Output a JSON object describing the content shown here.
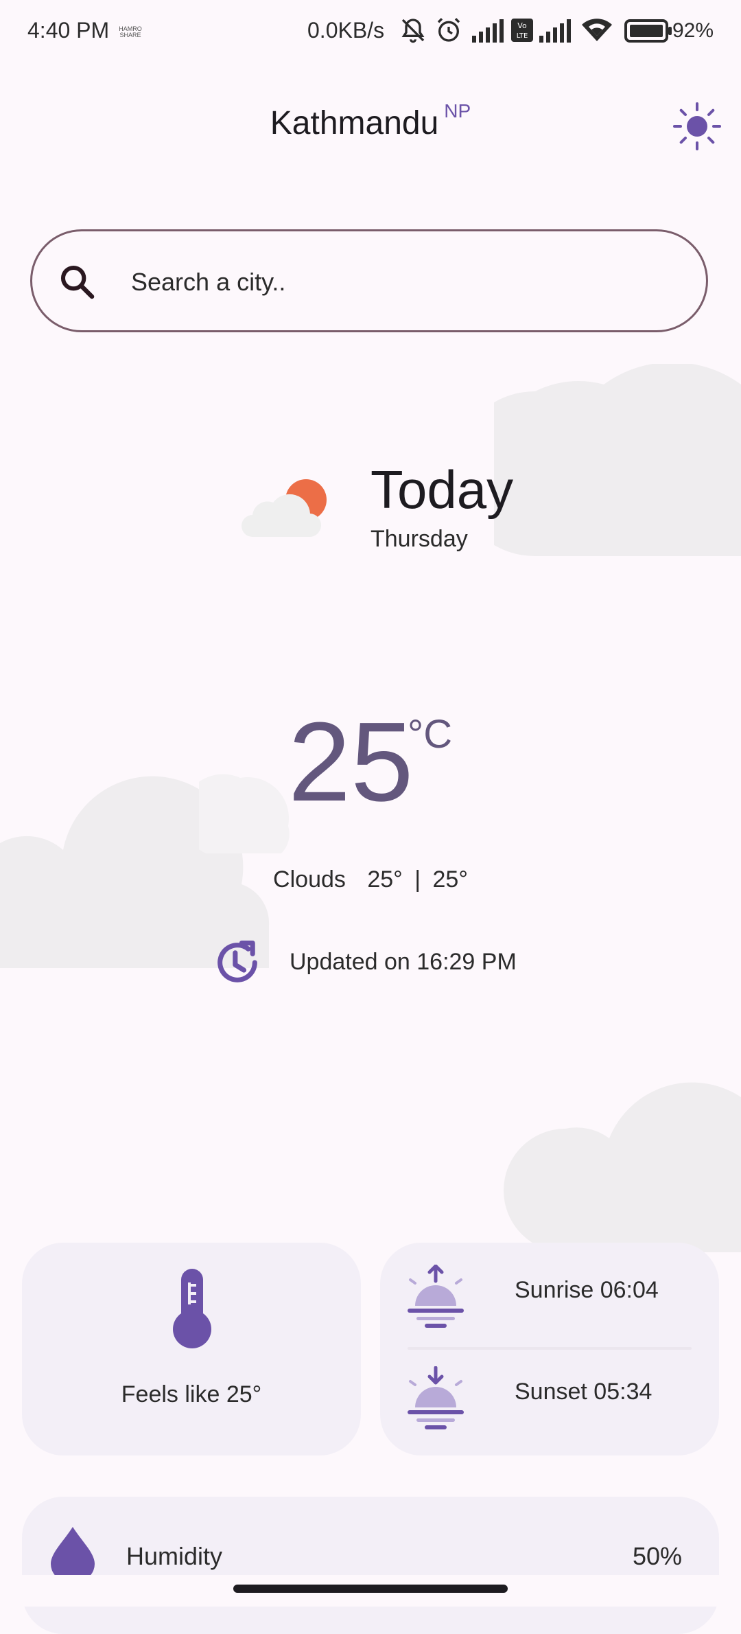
{
  "status_bar": {
    "time": "4:40 PM",
    "brand": "HAMRO SHARE",
    "network_rate": "0.0KB/s",
    "battery": "92%"
  },
  "header": {
    "city": "Kathmandu",
    "country": "NP",
    "theme_icon": "sun-icon"
  },
  "search": {
    "placeholder": "Search a city.."
  },
  "today": {
    "title": "Today",
    "day": "Thursday",
    "icon": "partly-cloudy-icon"
  },
  "current": {
    "temperature": "25",
    "unit": "°C",
    "condition": "Clouds",
    "high": "25°",
    "separator": "|",
    "low": "25°",
    "updated": "Updated on 16:29 PM"
  },
  "cards": {
    "feels_like": "Feels like 25°",
    "sunrise": "Sunrise 06:04",
    "sunset": "Sunset 05:34",
    "humidity_label": "Humidity",
    "humidity_value": "50%"
  },
  "colors": {
    "accent": "#6b52a8",
    "temperature": "#63577d",
    "sun_orange": "#ec6e47",
    "card_bg": "#f3eff7",
    "background": "#fdf8fc"
  }
}
